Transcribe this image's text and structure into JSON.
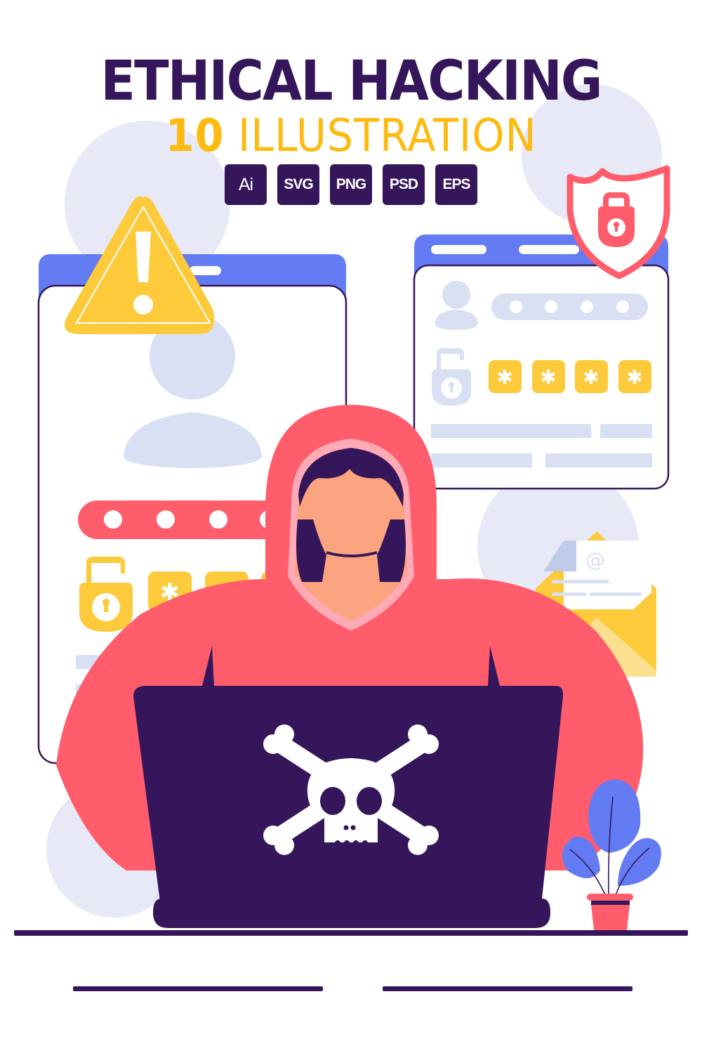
{
  "header": {
    "title": "ETHICAL HACKING",
    "subtitle_number": "10",
    "subtitle_text": "ILLUSTRATION"
  },
  "formats": [
    "Ai",
    "SVG",
    "PNG",
    "PSD",
    "EPS"
  ],
  "illustration": {
    "email_symbol": "@",
    "password_mask_count": 4,
    "colors": {
      "navy": "#36165a",
      "yellow": "#fdbb12",
      "coral": "#ff5d6c",
      "blue": "#637bf3",
      "lavender": "#dae0f4",
      "bg_circle": "#e7e9f6",
      "skin": "#fca47f",
      "pink_trim": "#ffaab4",
      "amber": "#fdca3b",
      "pale_yellow": "#fde08f"
    }
  }
}
